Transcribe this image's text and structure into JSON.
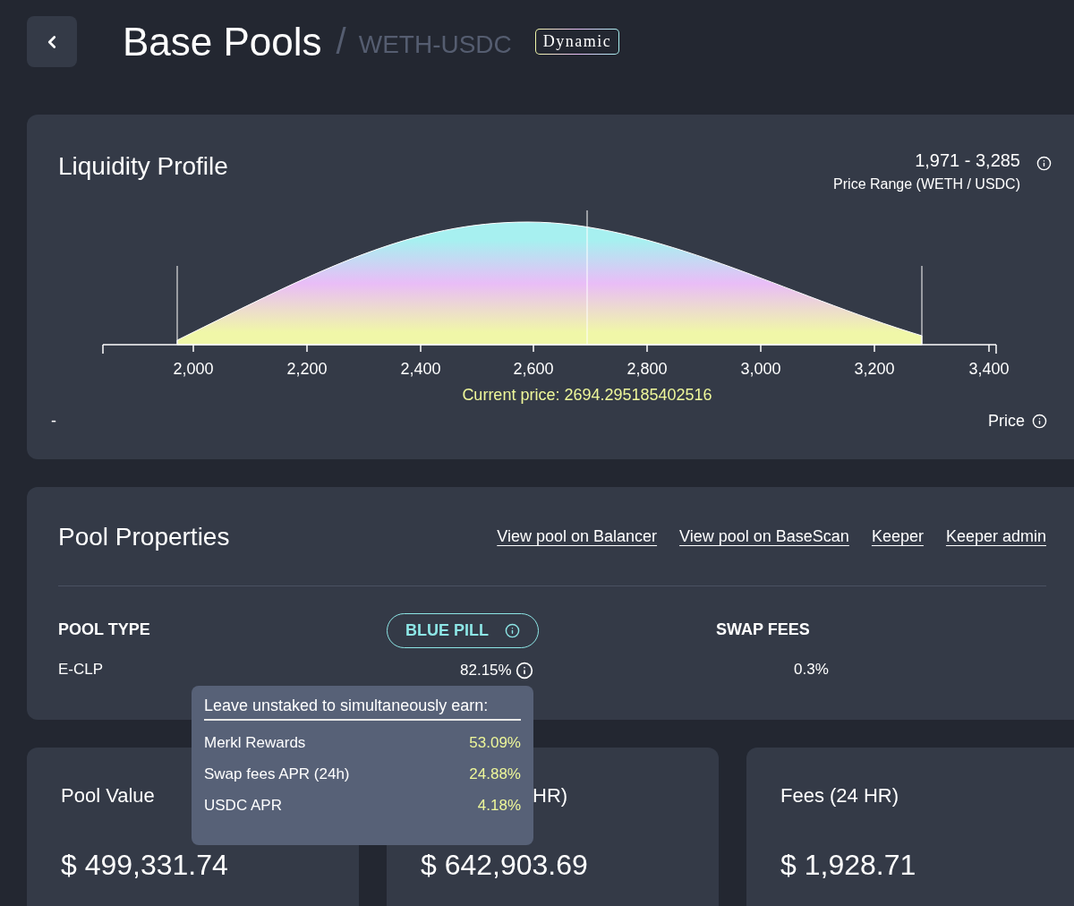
{
  "header": {
    "title": "Base Pools",
    "separator": "/",
    "pair": "WETH-USDC",
    "badge": "Dynamic"
  },
  "liquidity": {
    "title": "Liquidity Profile",
    "range_value": "1,971 - 3,285",
    "range_label": "Price Range (WETH / USDC)",
    "axis_ticks": [
      "2,000",
      "2,200",
      "2,400",
      "2,600",
      "2,800",
      "3,000",
      "3,200",
      "3,400"
    ],
    "current_price_label": "Current price:",
    "current_price": "2694.295185402516",
    "footer_left": "-",
    "footer_right": "Price"
  },
  "properties": {
    "title": "Pool Properties",
    "links": [
      "View pool on Balancer",
      "View pool on BaseScan",
      "Keeper",
      "Keeper admin"
    ],
    "columns": [
      {
        "kind": "heading",
        "label": "POOL TYPE",
        "value": "E-CLP"
      },
      {
        "kind": "pill",
        "label": "BLUE PILL",
        "value": "82.15%"
      },
      {
        "kind": "heading",
        "label": "SWAP FEES",
        "value": "0.3%"
      }
    ],
    "tooltip": {
      "title": "Leave unstaked to simultaneously earn:",
      "rows": [
        {
          "label": "Merkl Rewards",
          "value": "53.09%"
        },
        {
          "label": "Swap fees APR (24h)",
          "value": "24.88%"
        },
        {
          "label": "USDC APR",
          "value": "4.18%"
        }
      ]
    }
  },
  "stats": [
    {
      "label": "Pool Value",
      "value": "$ 499,331.74"
    },
    {
      "label": "HR)",
      "value": "$ 642,903.69"
    },
    {
      "label": "Fees (24 HR)",
      "value": "$ 1,928.71"
    }
  ]
}
